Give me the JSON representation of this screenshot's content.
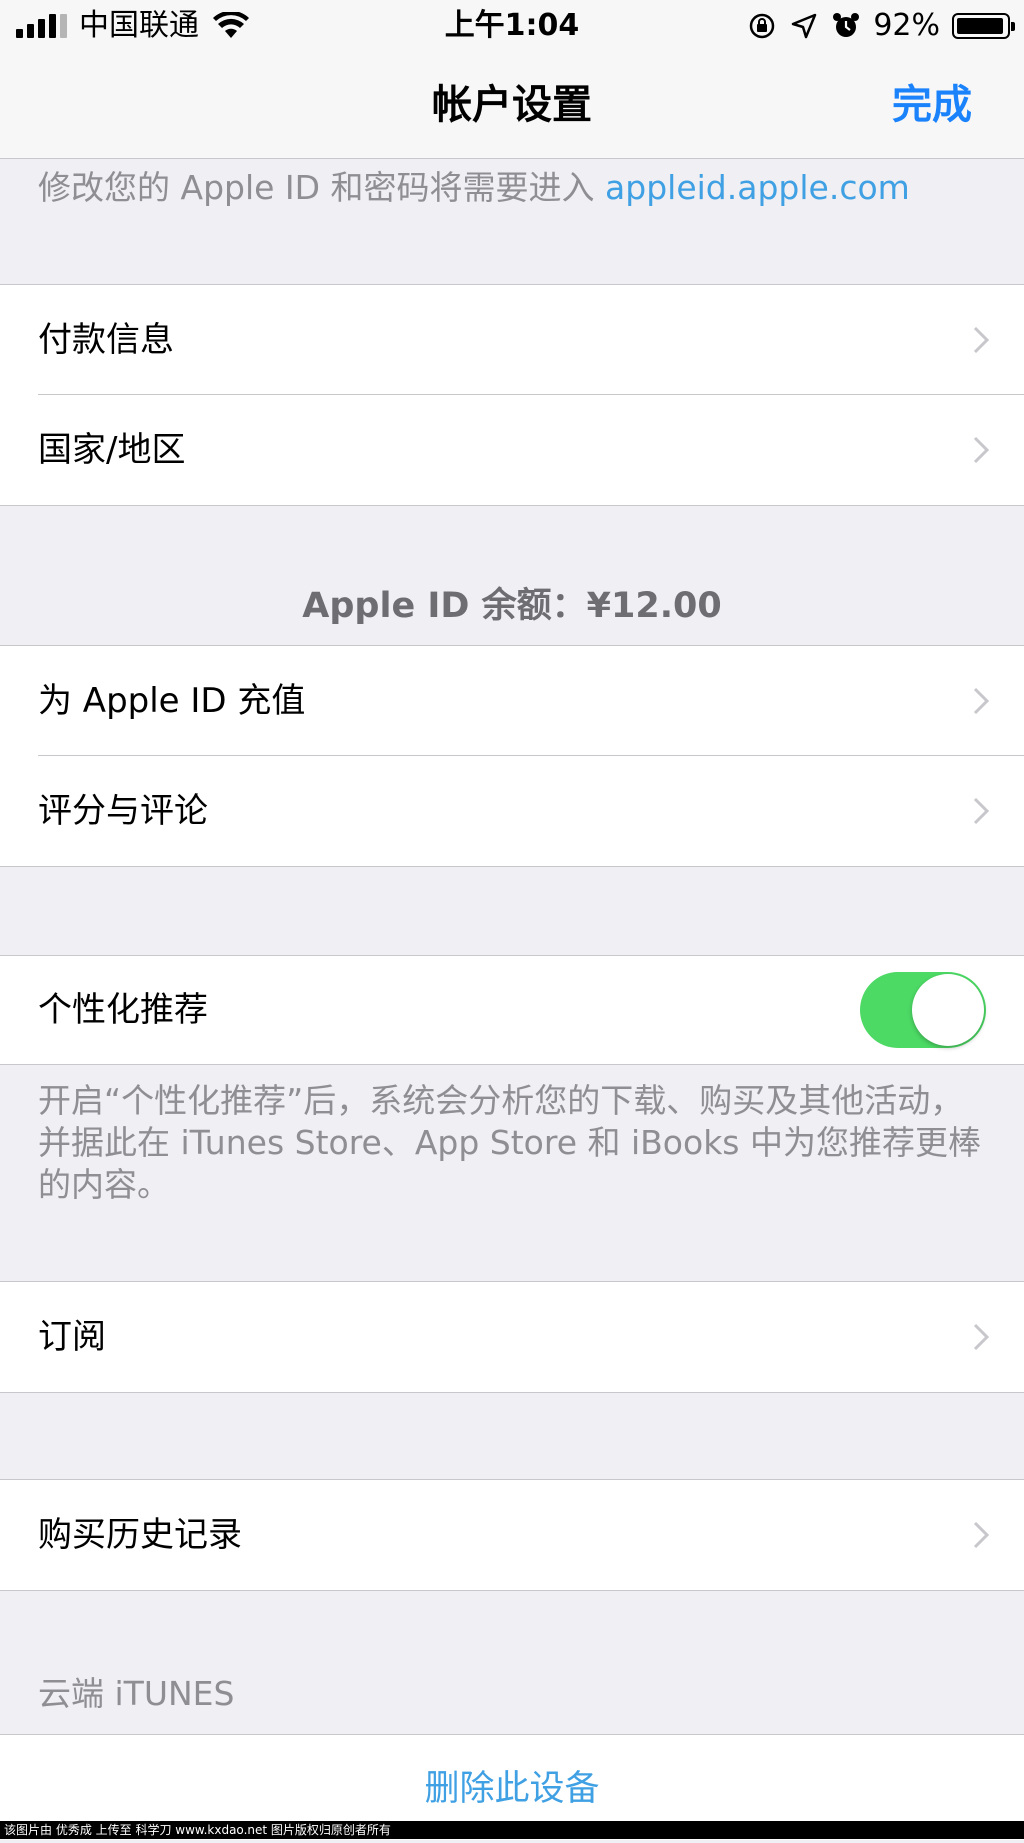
{
  "status_bar": {
    "carrier": "中国联通",
    "time": "上午1:04",
    "battery_percent": "92%",
    "battery_level": 0.92,
    "icons": [
      "signal-icon",
      "wifi-icon",
      "rotation-lock-icon",
      "location-icon",
      "alarm-icon",
      "battery-icon"
    ]
  },
  "nav": {
    "title": "帐户设置",
    "done": "完成"
  },
  "apple_id_note": {
    "text": "修改您的 Apple ID 和密码将需要进入 ",
    "link": "appleid.apple.com"
  },
  "group1": [
    {
      "label": "付款信息"
    },
    {
      "label": "国家/地区"
    }
  ],
  "balance": "Apple ID 余额：¥12.00",
  "group2": [
    {
      "label": "为 Apple ID 充值"
    },
    {
      "label": "评分与评论"
    }
  ],
  "personalized": {
    "label": "个性化推荐",
    "enabled": true,
    "description": "开启“个性化推荐”后，系统会分析您的下载、购买及其他活动，并据此在 iTunes Store、App Store 和 iBooks 中为您推荐更棒的内容。"
  },
  "subscriptions": {
    "label": "订阅"
  },
  "purchase_history": {
    "label": "购买历史记录"
  },
  "cloud_section": {
    "header": "云端 iTUNES",
    "remove_device": "删除此设备"
  },
  "colors": {
    "accent": "#1a82fb",
    "link": "#3fa0e3",
    "toggle_on": "#4cd964",
    "background": "#efeff4"
  },
  "watermark": "该图片由 优秀成 上传至 科学刀 www.kxdao.net 图片版权归原创者所有"
}
